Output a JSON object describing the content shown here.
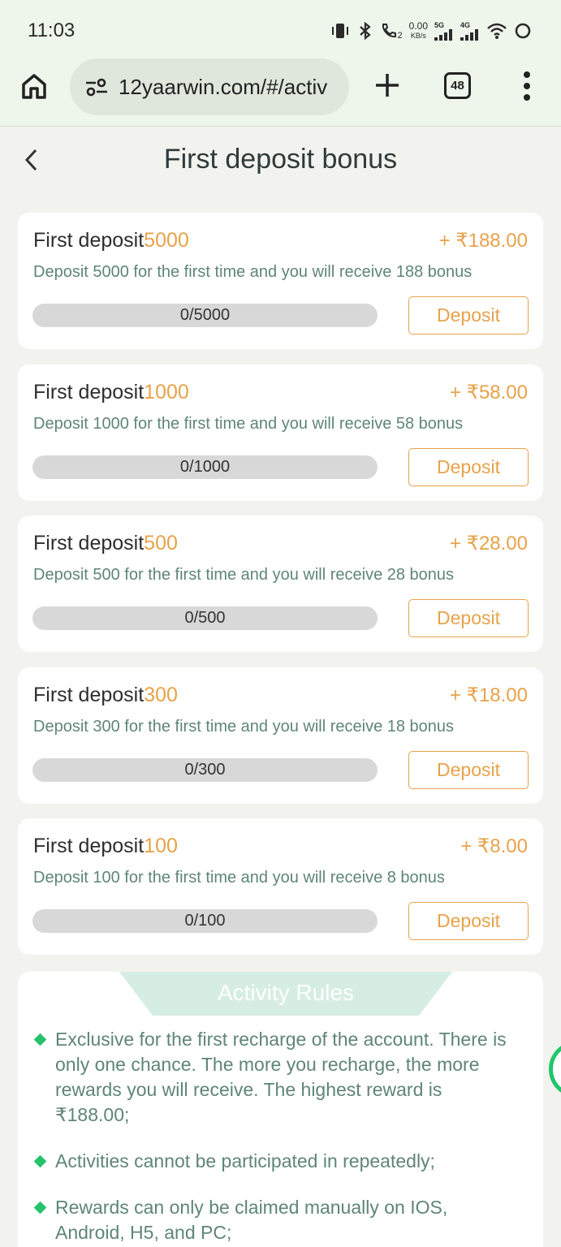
{
  "status_bar": {
    "time": "11:03",
    "call_sim": "2",
    "speed_value": "0.00",
    "speed_unit": "KB/s",
    "net1": "5G",
    "net2": "4G",
    "icons": [
      "vibrate-icon",
      "bluetooth-icon",
      "call-icon",
      "signal-icon",
      "signal-icon",
      "wifi-icon",
      "loading-icon"
    ]
  },
  "browser": {
    "url": "12yaarwin.com/#/activ",
    "tab_count": "48"
  },
  "header": {
    "title": "First deposit bonus"
  },
  "cards": [
    {
      "title_prefix": "First deposit",
      "amount": "5000",
      "reward": "+ ₹188.00",
      "desc": "Deposit 5000 for the first time and you will receive 188 bonus",
      "progress_text": "0/5000",
      "progress_fraction": 0,
      "button": "Deposit"
    },
    {
      "title_prefix": "First deposit",
      "amount": "1000",
      "reward": "+ ₹58.00",
      "desc": "Deposit 1000 for the first time and you will receive 58 bonus",
      "progress_text": "0/1000",
      "progress_fraction": 0,
      "button": "Deposit"
    },
    {
      "title_prefix": "First deposit",
      "amount": "500",
      "reward": "+ ₹28.00",
      "desc": "Deposit 500 for the first time and you will receive 28 bonus",
      "progress_text": "0/500",
      "progress_fraction": 0,
      "button": "Deposit"
    },
    {
      "title_prefix": "First deposit",
      "amount": "300",
      "reward": "+ ₹18.00",
      "desc": "Deposit 300 for the first time and you will receive 18 bonus",
      "progress_text": "0/300",
      "progress_fraction": 0,
      "button": "Deposit"
    },
    {
      "title_prefix": "First deposit",
      "amount": "100",
      "reward": "+ ₹8.00",
      "desc": "Deposit 100 for the first time and you will receive 8 bonus",
      "progress_text": "0/100",
      "progress_fraction": 0,
      "button": "Deposit"
    }
  ],
  "rules": {
    "title": "Activity Rules",
    "items": [
      "Exclusive for the first recharge of the account. There is only one chance. The more you recharge, the more rewards you will receive. The highest reward is ₹188.00;",
      "Activities cannot be participated in repeatedly;",
      "Rewards can only be claimed manually on IOS, Android, H5, and PC;"
    ]
  },
  "colors": {
    "accent": "#e8a24a",
    "description_text": "#5f8577",
    "rule_bullet": "#23c26b",
    "rules_tab": "#d6ede3",
    "page_bg": "#f2f2ef",
    "browser_bar": "#eef6ec"
  }
}
